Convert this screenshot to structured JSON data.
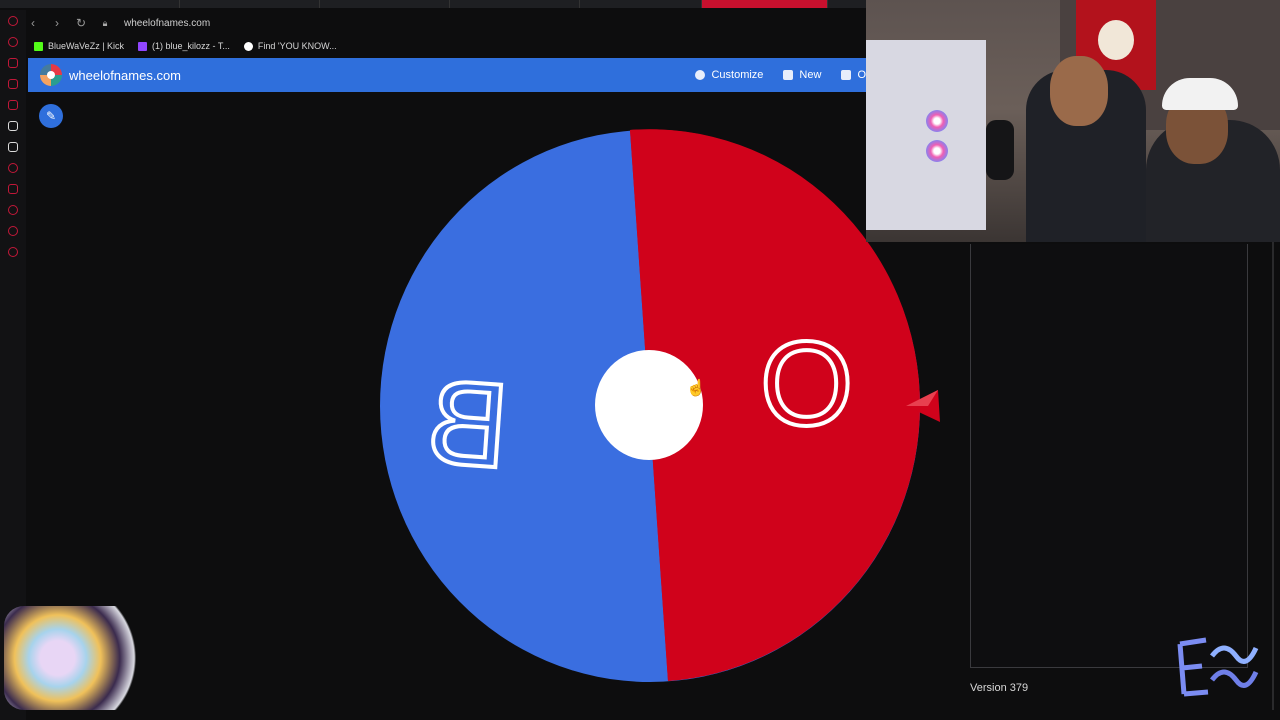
{
  "browser": {
    "url": "wheelofnames.com",
    "bookmarks": [
      {
        "label": "BlueWaVeZz | Kick",
        "color": "#53fc18"
      },
      {
        "label": "(1) blue_kilozz - T...",
        "color": "#9146ff"
      },
      {
        "label": "Find 'YOU KNOW...",
        "color": "#ffffff"
      }
    ]
  },
  "app": {
    "site_title": "wheelofnames.com",
    "menu": {
      "customize": "Customize",
      "new": "New",
      "open_partial": "O"
    }
  },
  "wheel": {
    "segments": [
      {
        "label": "B",
        "color": "#3a6ee0"
      },
      {
        "label": "O",
        "color": "#d0021b"
      }
    ],
    "hub_color": "#ffffff",
    "pointer_color": "#d0021b"
  },
  "panel": {
    "version": "Version 379"
  },
  "colors": {
    "accent": "#2f6fdc",
    "sidebar_icons": "#c21839"
  },
  "icons": {
    "edit": "pencil-icon",
    "customize": "palette-icon",
    "new": "file-icon",
    "open": "folder-icon"
  }
}
